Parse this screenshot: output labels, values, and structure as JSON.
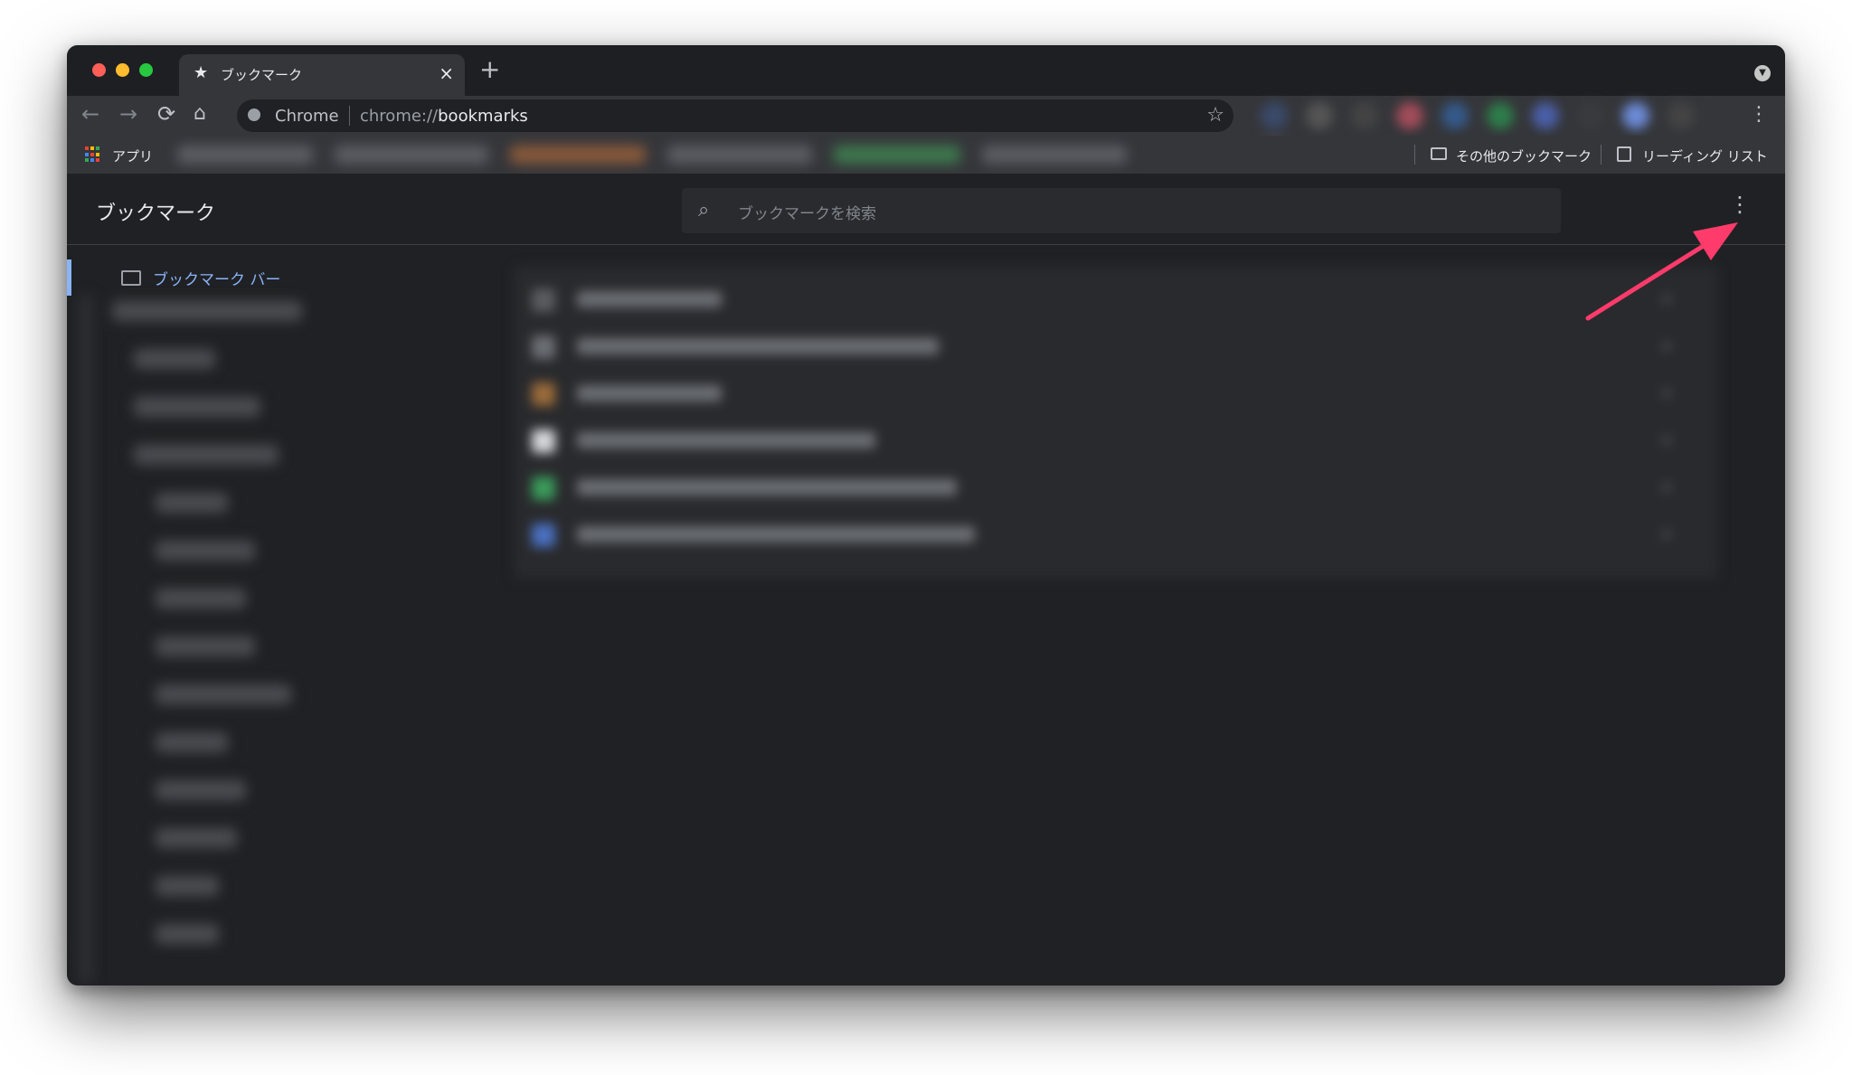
{
  "tab": {
    "title": "ブックマーク",
    "close": "×",
    "new_tab": "+"
  },
  "toolbar": {
    "back": "←",
    "forward": "→",
    "reload": "⟳",
    "home": "⌂",
    "site_label": "Chrome",
    "url_prefix": "chrome://",
    "url_path": "bookmarks",
    "star": "☆",
    "menu": "⋮"
  },
  "bookmarks_bar": {
    "apps_label": "アプリ",
    "other_bookmarks": "その他のブックマーク",
    "reading_list": "リーディング リスト"
  },
  "manager": {
    "title": "ブックマーク",
    "search_placeholder": "ブックマークを検索",
    "menu": "⋮",
    "sidebar_selected": "ブックマーク バー"
  },
  "colors": {
    "window_bg": "#202124",
    "toolbar_bg": "#35363a",
    "accent": "#8ab4f8",
    "annotation_arrow": "#ff3b6b"
  },
  "icons": {
    "tab": "star-icon",
    "search": "search-icon",
    "folder": "folder-icon",
    "reading_list": "reading-list-icon",
    "apps": "apps-grid-icon"
  }
}
